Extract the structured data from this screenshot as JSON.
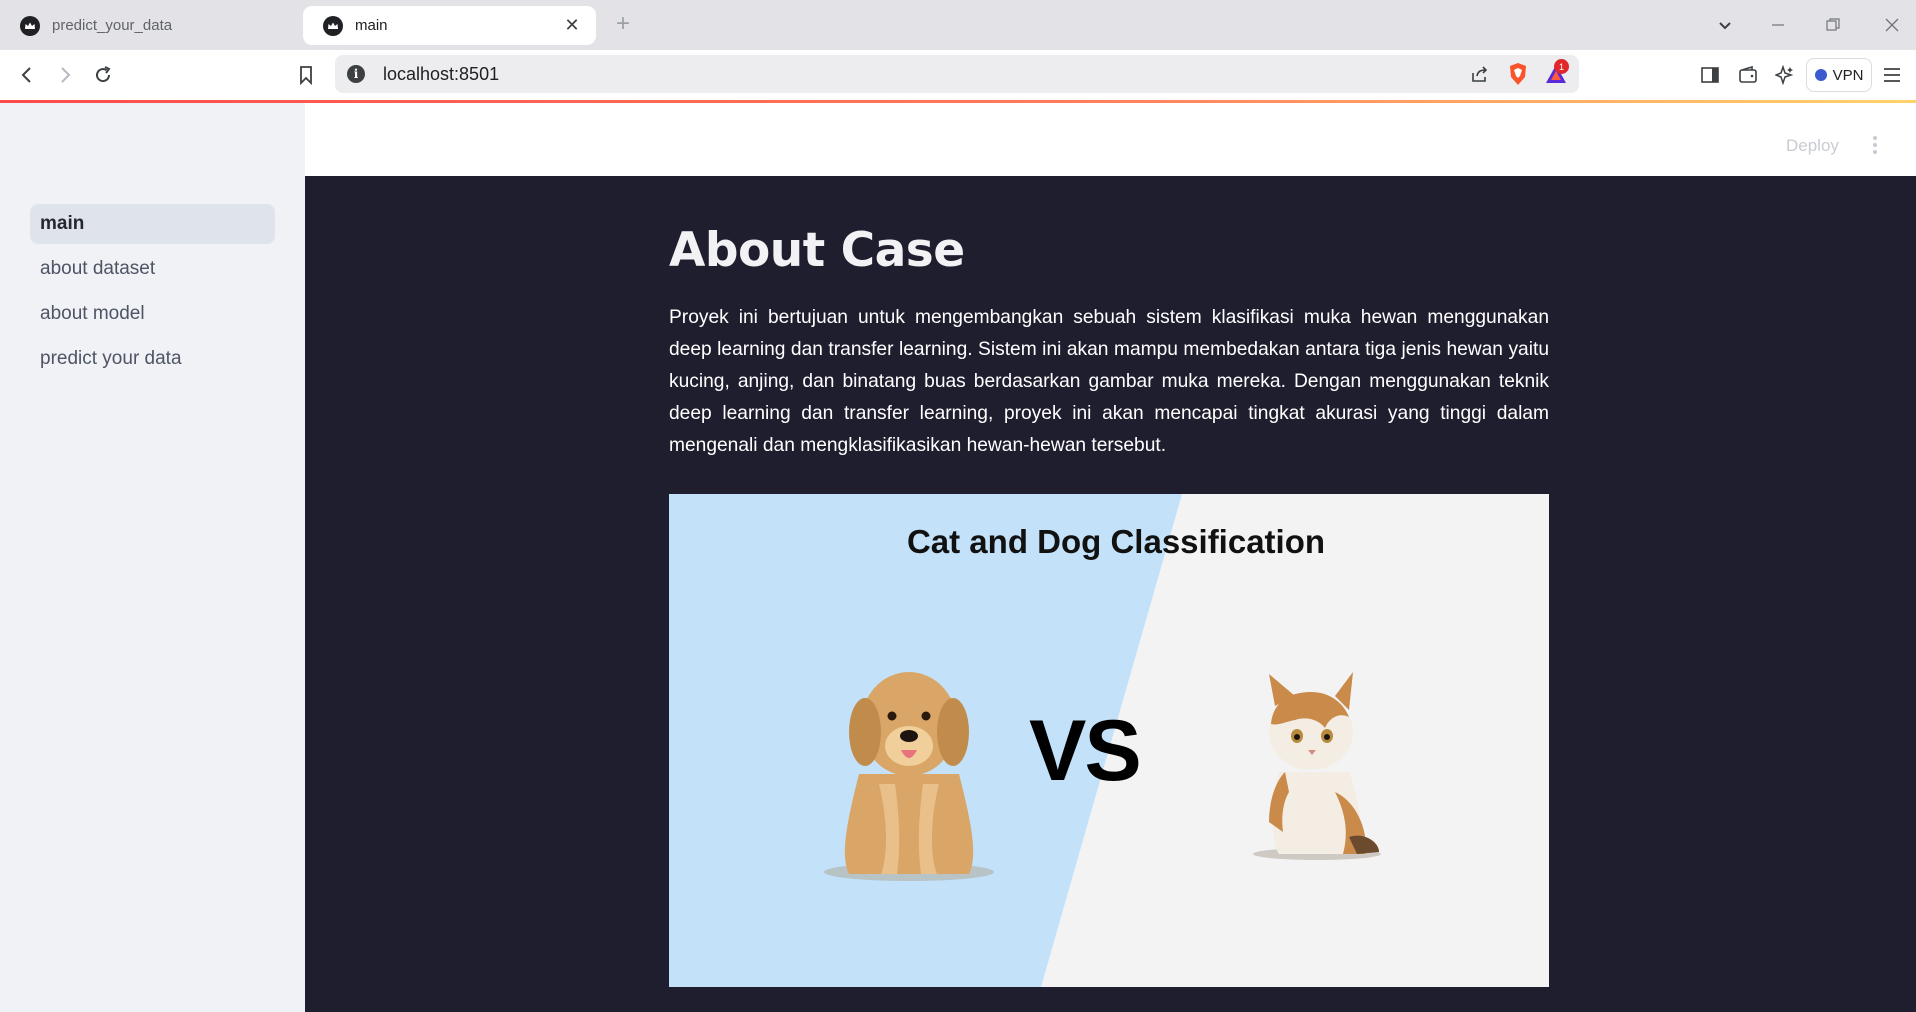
{
  "browser": {
    "tabs": [
      {
        "label": "predict_your_data",
        "active": false
      },
      {
        "label": "main",
        "active": true
      }
    ],
    "url": "localhost:8501",
    "vpn_label": "VPN",
    "notification_count": "1"
  },
  "app": {
    "deploy_label": "Deploy",
    "sidebar": {
      "items": [
        {
          "label": "main",
          "active": true
        },
        {
          "label": "about dataset",
          "active": false
        },
        {
          "label": "about model",
          "active": false
        },
        {
          "label": "predict your data",
          "active": false
        }
      ]
    },
    "page": {
      "title": "About Case",
      "description": "Proyek ini bertujuan untuk mengembangkan sebuah sistem klasifikasi muka hewan menggunakan deep learning dan transfer learning. Sistem ini akan mampu membedakan antara tiga jenis hewan yaitu kucing, anjing, dan binatang buas berdasarkan gambar muka mereka. Dengan menggunakan teknik deep learning dan transfer learning, proyek ini akan mencapai tingkat akurasi yang tinggi dalam mengenali dan mengklasifikasikan hewan-hewan tersebut.",
      "image": {
        "title": "Cat and Dog Classification",
        "vs_text": "VS"
      }
    }
  },
  "colors": {
    "accent_line_start": "#ff4b4b",
    "accent_line_end": "#ffd36b",
    "sidebar_bg": "#f0f2f6",
    "main_bg": "#1f1e2e",
    "image_blue": "#c3e1f8"
  }
}
